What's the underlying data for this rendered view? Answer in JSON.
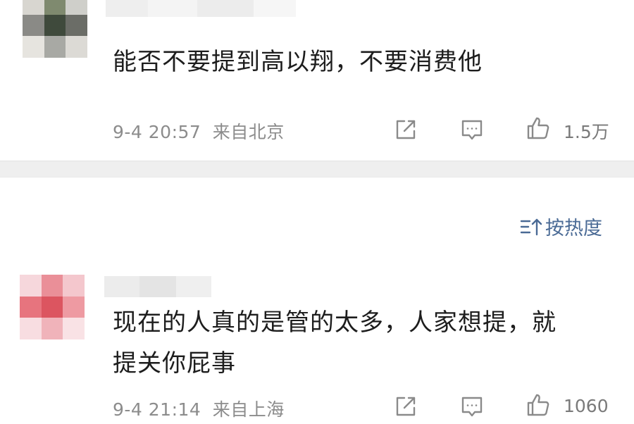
{
  "comments": [
    {
      "text": "能否不要提到高以翔，不要消费他",
      "time": "9-4 20:57",
      "location": "来自北京",
      "likes": "1.5万"
    },
    {
      "text_line1": "现在的人真的是管的太多，人家想提，就",
      "text_line2": "提关你屁事",
      "time": "9-4 21:14",
      "location": "来自上海",
      "likes": "1060"
    }
  ],
  "sort": {
    "label": "按热度",
    "icon": "sort-icon"
  },
  "icons": {
    "share": "share-icon",
    "comment": "comment-icon",
    "like": "like-icon"
  },
  "colors": {
    "meta_text": "#8c8c8c",
    "sort_accent": "#4a6a95",
    "divider": "#efefef"
  }
}
